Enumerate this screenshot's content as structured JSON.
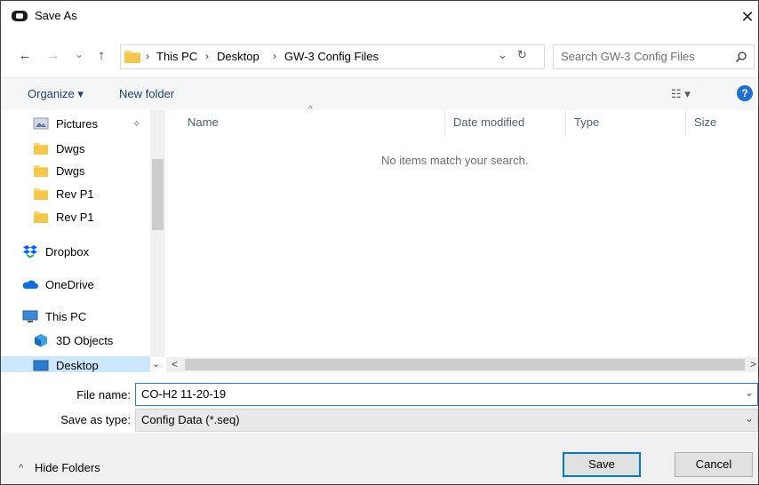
{
  "window": {
    "title": "Save As",
    "close_glyph": "✕"
  },
  "nav": {
    "back_glyph": "←",
    "forward_glyph": "→",
    "recent_glyph": "⌄",
    "up_glyph": "↑"
  },
  "address": {
    "sep": "›",
    "crumbs": [
      "This PC",
      "Desktop",
      "GW-3 Config Files"
    ],
    "dropdown_glyph": "⌄",
    "refresh_glyph": "↻"
  },
  "search": {
    "placeholder": "Search GW-3 Config Files",
    "icon": "search-icon"
  },
  "toolbar": {
    "organize_label": "Organize ▾",
    "new_folder_label": "New folder",
    "view_glyph": "☷ ▾",
    "help_glyph": "?"
  },
  "sidebar": {
    "items": [
      {
        "label": "Pictures",
        "icon": "pictures-folder-icon"
      },
      {
        "label": "Dwgs",
        "icon": "folder-icon"
      },
      {
        "label": "Dwgs",
        "icon": "folder-icon"
      },
      {
        "label": "Rev P1",
        "icon": "folder-icon"
      },
      {
        "label": "Rev P1",
        "icon": "folder-icon"
      },
      {
        "label": "Dropbox",
        "icon": "dropbox-icon"
      },
      {
        "label": "OneDrive",
        "icon": "onedrive-icon"
      },
      {
        "label": "This PC",
        "icon": "this-pc-icon"
      },
      {
        "label": "3D Objects",
        "icon": "3d-objects-icon"
      },
      {
        "label": "Desktop",
        "icon": "desktop-icon"
      }
    ],
    "pin_glyph": "✧",
    "scroll_up_glyph": "^",
    "scroll_down_glyph": "⌄"
  },
  "file_list": {
    "columns": [
      "Name",
      "Date modified",
      "Type",
      "Size"
    ],
    "sort_glyph": "^",
    "empty_message": "No items match your search."
  },
  "hscroll": {
    "left_glyph": "<",
    "right_glyph": ">"
  },
  "form": {
    "file_name_label": "File name:",
    "file_name_value": "CO-H2 11-20-19",
    "save_type_label": "Save as type:",
    "save_type_value": "Config Data (*.seq)",
    "dropdown_glyph": "⌄"
  },
  "footer": {
    "hide_folders_label": "Hide Folders",
    "hide_glyph": "^",
    "save_label": "Save",
    "cancel_label": "Cancel"
  },
  "colors": {
    "accent": "#0078d7",
    "selection": "#cce8ff",
    "folder": "#f8d775"
  }
}
